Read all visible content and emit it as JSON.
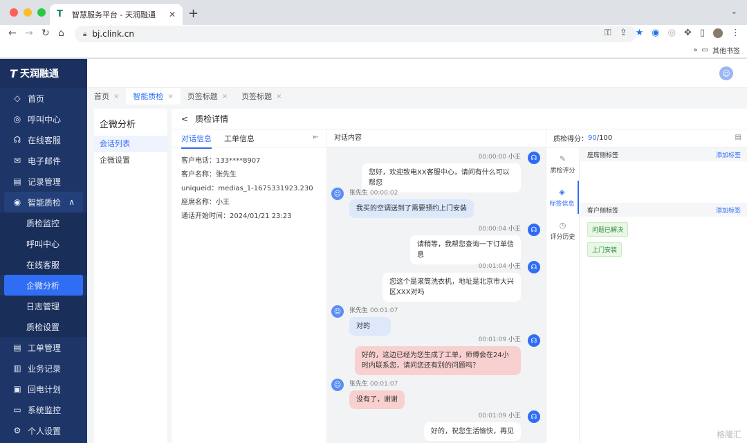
{
  "browser": {
    "tab_title": "智慧服务平台 - 天润融通",
    "url": "bj.clink.cn",
    "bookmarks_label": "其他书签",
    "bookmarks_more": "»"
  },
  "app": {
    "logo_text": "天润融通",
    "logo_mark": "T",
    "sidebar": {
      "items_top": [
        {
          "label": "首页",
          "icon": "◇"
        },
        {
          "label": "呼叫中心",
          "icon": "◎"
        },
        {
          "label": "在线客服",
          "icon": "☊"
        },
        {
          "label": "电子邮件",
          "icon": "✉"
        },
        {
          "label": "记录管理",
          "icon": "▤"
        }
      ],
      "open_group": {
        "label": "智能质检",
        "icon": "◉",
        "arrow": "∧"
      },
      "sub_items": [
        "质检监控",
        "呼叫中心",
        "在线客服",
        "企微分析",
        "日志管理",
        "质检设置"
      ],
      "active_sub": "企微分析",
      "items_bottom": [
        {
          "label": "工单管理",
          "icon": "▤"
        },
        {
          "label": "业务记录",
          "icon": "▥"
        },
        {
          "label": "回电计划",
          "icon": "▣"
        },
        {
          "label": "系统监控",
          "icon": "▭"
        },
        {
          "label": "个人设置",
          "icon": "⚙"
        }
      ]
    },
    "page_tabs": [
      {
        "label": "首页",
        "active": false
      },
      {
        "label": "智能质检",
        "active": true
      },
      {
        "label": "页签标题",
        "active": false
      },
      {
        "label": "页签标题",
        "active": false
      }
    ],
    "left_panel": {
      "title": "企微分析",
      "items": [
        "会话列表",
        "企微设置"
      ]
    },
    "detail": {
      "back": "<",
      "title": "质检详情",
      "info_tabs": [
        "对话信息",
        "工单信息"
      ],
      "info_rows": [
        "客户电话：133****8907",
        "客户名称：张先生",
        "uniqueid：medias_1-1675331923.230",
        "座席名称：小王",
        "通话开始时间：2024/01/21 23:23"
      ],
      "chat_title": "对话内容",
      "messages": [
        {
          "role": "agent",
          "time": "00:00:00",
          "name": "小王",
          "text": "您好，欢迎致电XX客服中心，请问有什么可以帮您"
        },
        {
          "role": "cust",
          "time": "00:00:02",
          "name": "张先生",
          "text": "我买的空调送到了需要预约上门安装"
        },
        {
          "role": "agent",
          "time": "00:00:04",
          "name": "小王",
          "text": "请稍等，我帮您查询一下订单信息"
        },
        {
          "role": "agent",
          "time": "00:01:04",
          "name": "小王",
          "text": "您这个是滚筒洗衣机，地址是北京市大兴区XXX对吗"
        },
        {
          "role": "cust",
          "time": "00:01:07",
          "name": "张先生",
          "text": "对的"
        },
        {
          "role": "agent-warn",
          "time": "00:01:09",
          "name": "小王",
          "text": "好的，这边已经为您生成了工单，师傅会在24小时内联系您，请问您还有别的问题吗？"
        },
        {
          "role": "cust-warn",
          "time": "00:01:07",
          "name": "张先生",
          "text": "没有了，谢谢"
        },
        {
          "role": "agent",
          "time": "00:01:09",
          "name": "小王",
          "text": "好的，祝您生活愉快，再见"
        }
      ],
      "score": {
        "label": "质检得分：",
        "value": "90",
        "total": "/100",
        "vtabs": [
          {
            "label": "质检评分",
            "icon": "✎"
          },
          {
            "label": "标签信息",
            "icon": "◈"
          },
          {
            "label": "评分历史",
            "icon": "◷"
          }
        ],
        "active_vtab": "标签信息",
        "agent_tags_title": "座席侧标签",
        "customer_tags_title": "客户侧标签",
        "add_label": "添加标签",
        "customer_tags": [
          "问题已解决",
          "上门安装"
        ]
      }
    },
    "watermark": "格隆汇"
  },
  "colors": {
    "sidebar": "#1e3567",
    "accent": "#2f6df5"
  }
}
